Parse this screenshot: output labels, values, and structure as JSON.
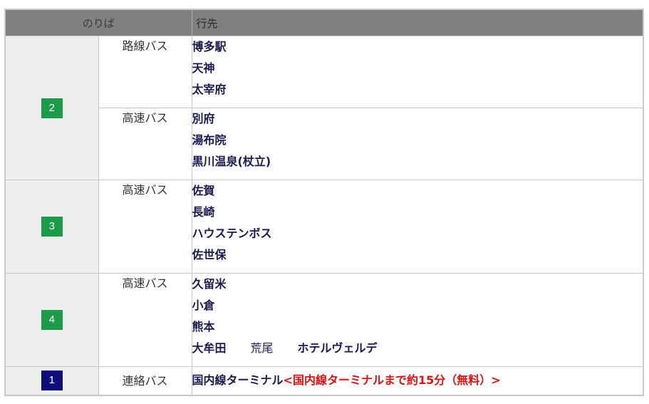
{
  "header": {
    "noriba": "のりば",
    "destination": "行先"
  },
  "rows": [
    {
      "platform": "2",
      "badge_color": "#1b9a4a",
      "groups": [
        {
          "type": "路線バス",
          "destinations": [
            "博多駅",
            "天神",
            "太宰府"
          ]
        },
        {
          "type": "高速バス",
          "destinations": [
            "別府",
            "湯布院",
            "黒川温泉(杖立)"
          ]
        }
      ]
    },
    {
      "platform": "3",
      "badge_color": "#1b9a4a",
      "groups": [
        {
          "type": "高速バス",
          "destinations": [
            "佐賀",
            "長崎",
            "ハウステンボス",
            "佐世保"
          ]
        }
      ]
    },
    {
      "platform": "4",
      "badge_color": "#1b9a4a",
      "groups": [
        {
          "type": "高速バス",
          "destinations": [
            "久留米",
            "小倉",
            "熊本"
          ],
          "last_line": [
            "大牟田",
            "荒尾",
            "ホテルヴェルデ"
          ]
        }
      ]
    },
    {
      "platform": "1",
      "badge_color": "#0d0d7a",
      "groups": [
        {
          "type": "連絡バス",
          "destinations": [
            "国内線ターミナル"
          ],
          "note": "<国内線ターミナルまで約15分（無料）>"
        }
      ]
    }
  ]
}
